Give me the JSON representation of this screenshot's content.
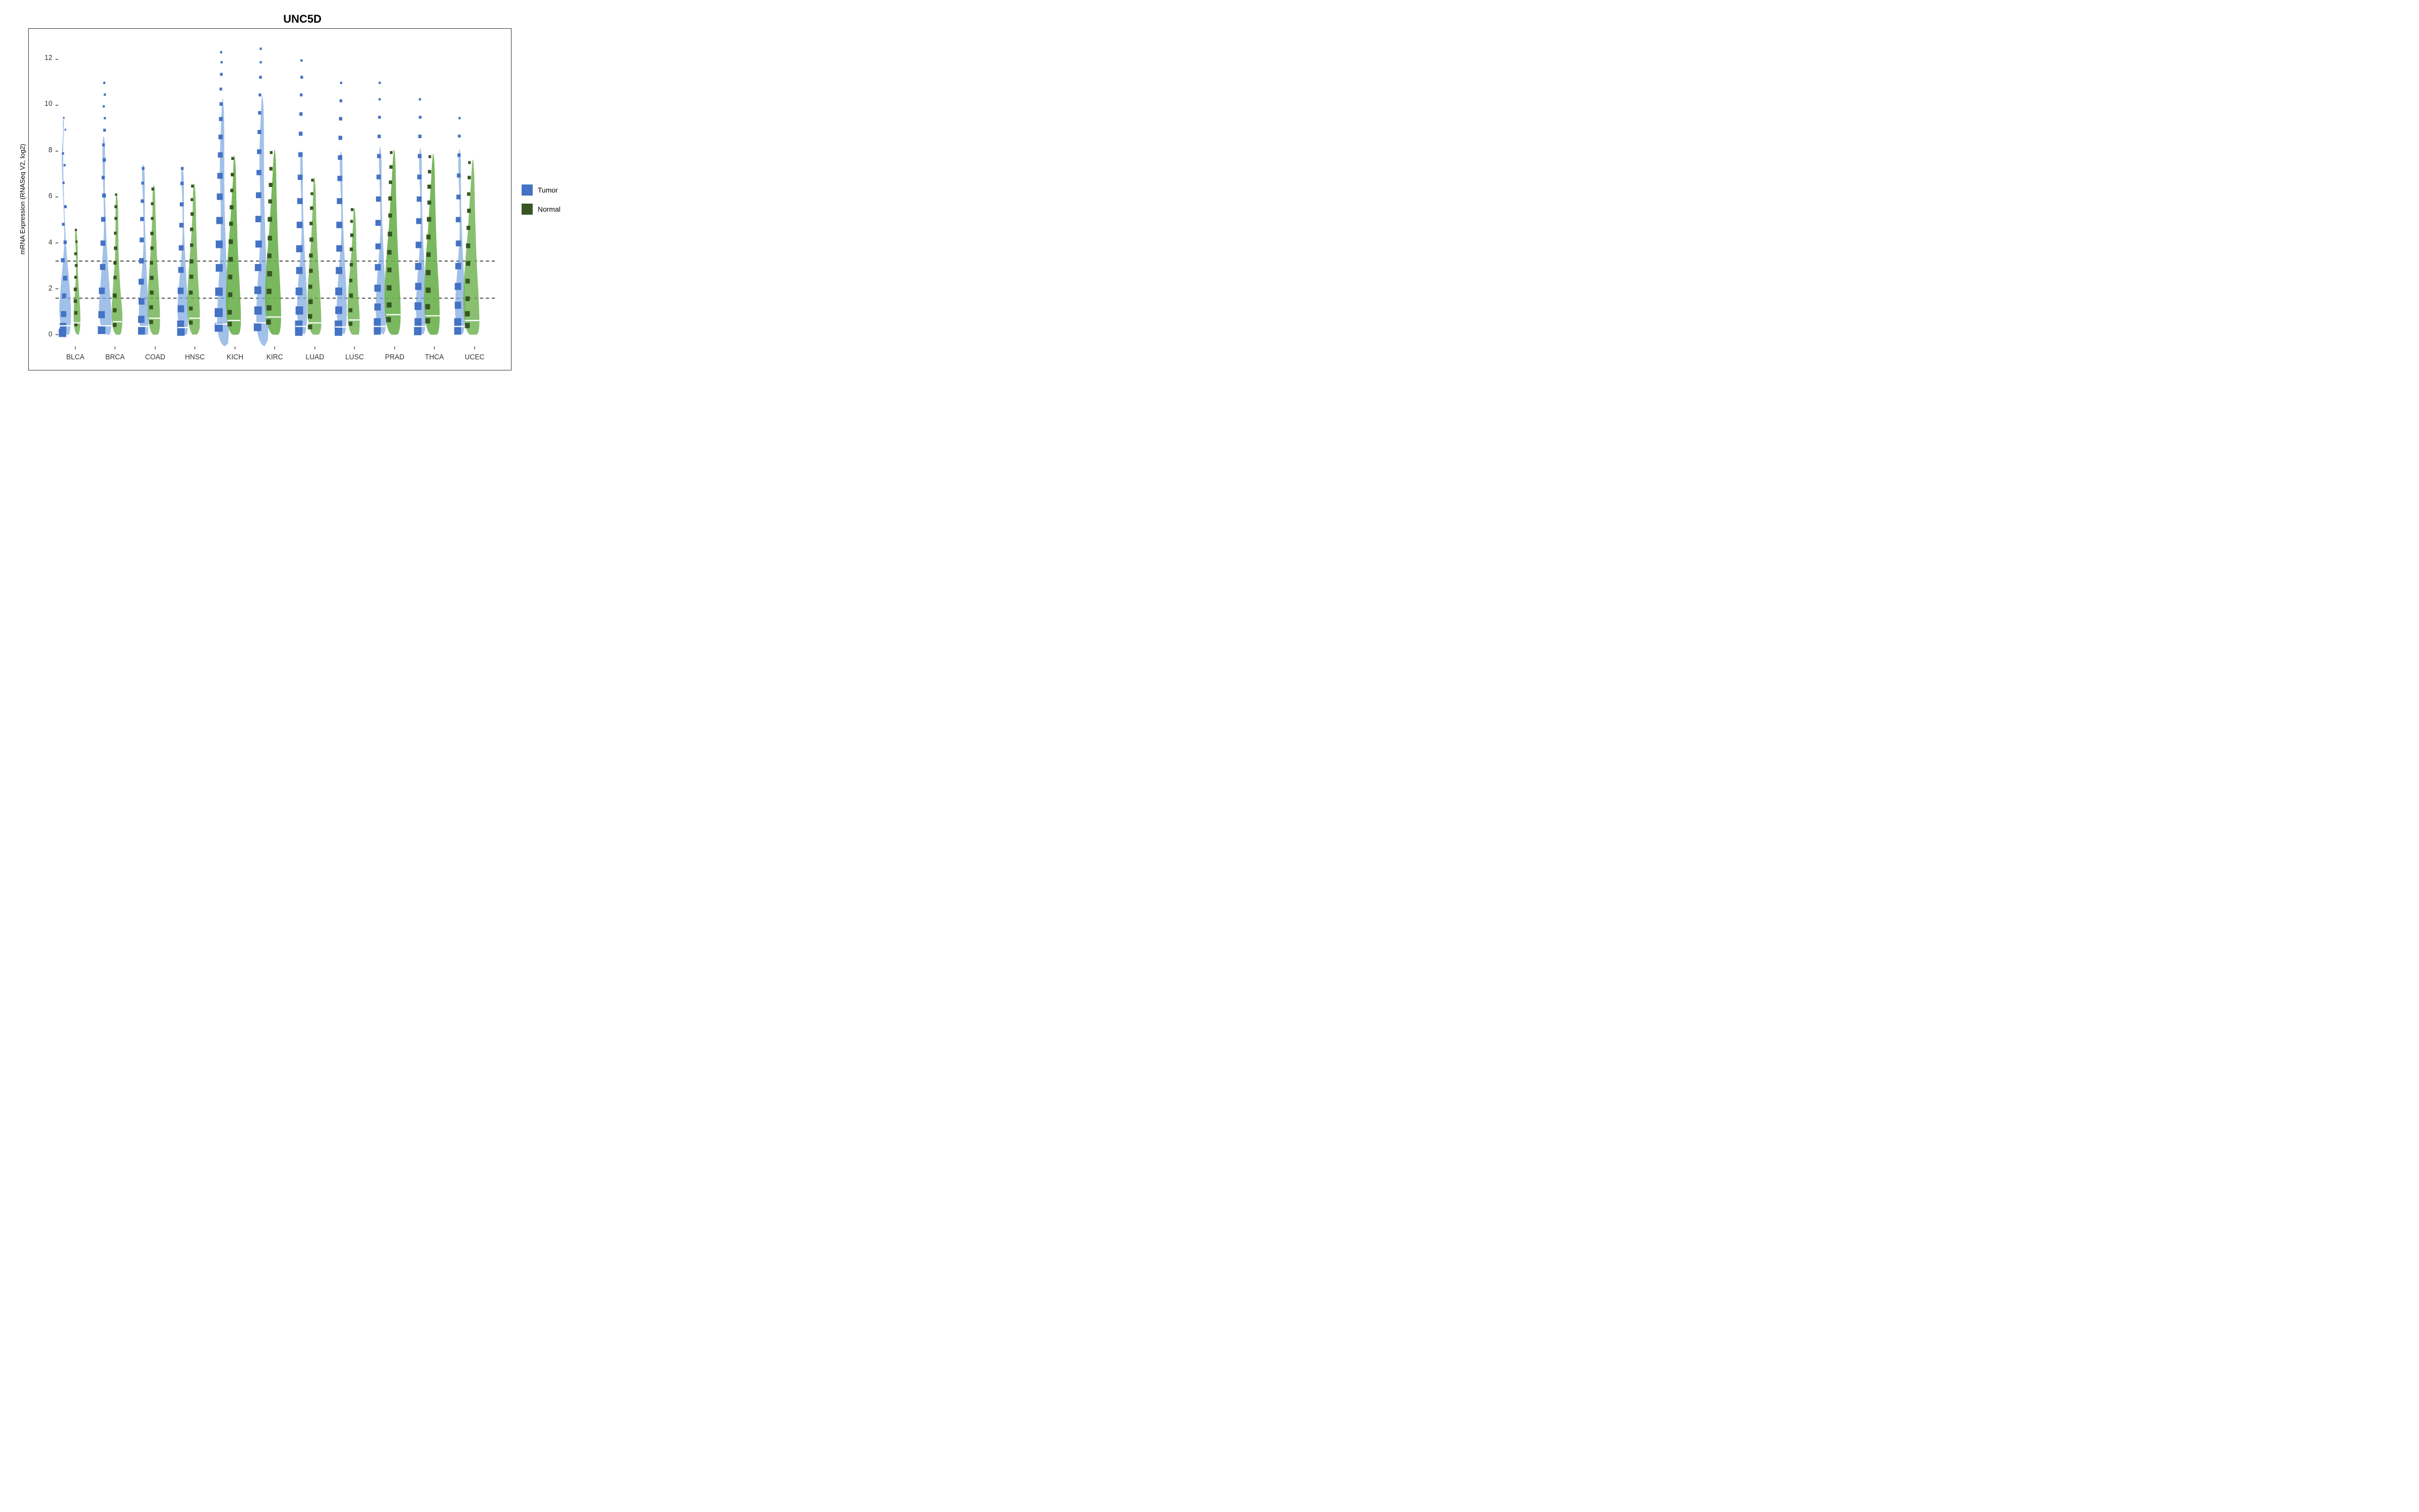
{
  "title": "UNC5D",
  "yAxisLabel": "mRNA Expression (RNASeq V2, log2)",
  "yAxisTicks": [
    0,
    2,
    4,
    6,
    8,
    10,
    12
  ],
  "xLabels": [
    "BLCA",
    "BRCA",
    "COAD",
    "HNSC",
    "KICH",
    "KIRC",
    "LUAD",
    "LUSC",
    "PRAD",
    "THCA",
    "UCEC"
  ],
  "legend": [
    {
      "label": "Tumor",
      "color": "#4472C4"
    },
    {
      "label": "Normal",
      "color": "#375623"
    }
  ],
  "dottedLines": [
    1.6,
    3.2
  ],
  "colors": {
    "tumor": "#4472C4",
    "normal": "#4a8c2a",
    "tumorLight": "#7ba7e0",
    "normalLight": "#6ab04c"
  }
}
